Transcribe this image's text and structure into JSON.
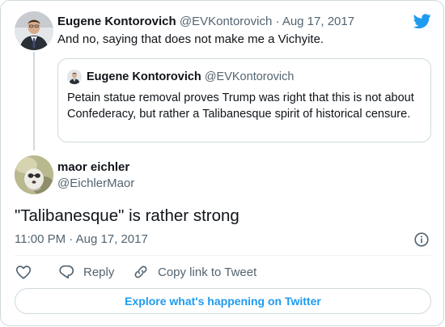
{
  "colors": {
    "twitter_blue": "#1d9bf0",
    "text_primary": "#0f1419",
    "text_secondary": "#536471",
    "border": "#cfd9de"
  },
  "parent_tweet": {
    "name": "Eugene Kontorovich",
    "handle": "@EVKontorovich",
    "separator": "·",
    "date": "Aug 17, 2017",
    "text": "And no, saying that does not make me a Vichyite.",
    "avatar_icon": "eugene-kontorovich-avatar"
  },
  "quoted_tweet": {
    "name": "Eugene Kontorovich",
    "handle": "@EVKontorovich",
    "text": "Petain statue removal proves Trump was right that this is not about Confederacy, but rather a Talibanesque spirit of historical censure.",
    "avatar_icon": "eugene-kontorovich-avatar"
  },
  "main_tweet": {
    "name": "maor eichler",
    "handle": "@EichlerMaor",
    "text": "\"Talibanesque\" is rather strong",
    "timestamp": "11:00 PM · Aug 17, 2017",
    "avatar_icon": "maor-eichler-avatar"
  },
  "actions": {
    "like_icon": "heart-icon",
    "reply_label": "Reply",
    "reply_icon": "reply-bubble-icon",
    "copy_label": "Copy link to Tweet",
    "copy_icon": "link-icon"
  },
  "icons": {
    "logo": "twitter-bird-icon",
    "info": "info-icon"
  },
  "explore_label": "Explore what's happening on Twitter"
}
